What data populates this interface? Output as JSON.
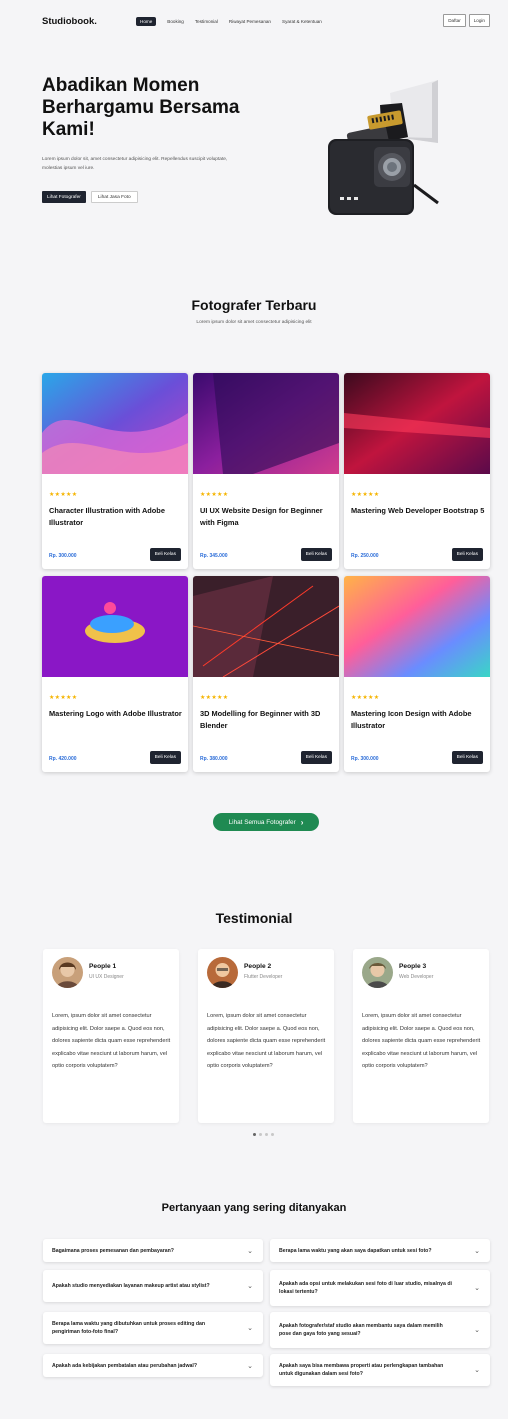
{
  "nav": {
    "brand": "Studiobook.",
    "items": [
      {
        "label": "Home"
      },
      {
        "label": "Booking"
      },
      {
        "label": "Testimonial"
      },
      {
        "label": "Riwayat Pemesanan"
      },
      {
        "label": "Syarat & Ketentuan"
      }
    ],
    "daftar": "Daftar",
    "login": "Login"
  },
  "hero": {
    "title": "Abadikan Momen Berhargamu Bersama Kami!",
    "description": "Lorem ipsum dolor sit, amet consectetur adipisicing elit. Repellendus suscipit voluptate, molestias ipsum vel iure.",
    "primary_button": "Lihat Fotografer",
    "secondary_button": "Lihat Jasa Foto"
  },
  "photographers": {
    "title": "Fotografer Terbaru",
    "subtitle": "Lorem ipsum dolor sit amet consectetur adipisicing elit",
    "cards": [
      {
        "title": "Character Illustration with Adobe Illustrator",
        "price": "Rp. 300.000",
        "button": "Beli Kelas",
        "rating": 5
      },
      {
        "title": "UI UX Website Design for Beginner with Figma",
        "price": "Rp. 345.000",
        "button": "Beli Kelas",
        "rating": 5
      },
      {
        "title": "Mastering Web Developer Bootstrap 5",
        "price": "Rp. 250.000",
        "button": "Beli Kelas",
        "rating": 5
      },
      {
        "title": "Mastering Logo with Adobe Illustrator",
        "price": "Rp. 420.000",
        "button": "Beli Kelas",
        "rating": 5
      },
      {
        "title": "3D Modelling for Beginner with 3D Blender",
        "price": "Rp. 380.000",
        "button": "Beli Kelas",
        "rating": 5
      },
      {
        "title": "Mastering Icon Design with Adobe Illustrator",
        "price": "Rp. 300.000",
        "button": "Beli Kelas",
        "rating": 5
      }
    ],
    "all_button": "Lihat Semua Fotografer"
  },
  "testimonial": {
    "title": "Testimonial",
    "items": [
      {
        "name": "People 1",
        "role": "UI UX Designer",
        "text": "Lorem, ipsum dolor sit amet consectetur adipisicing elit. Dolor saepe a. Quod eos non, dolores sapiente dicta quam esse reprehenderit explicabo vitae nesciunt ut laborum harum, vel optio corporis voluptatem?"
      },
      {
        "name": "People 2",
        "role": "Flutter Developer",
        "text": "Lorem, ipsum dolor sit amet consectetur adipisicing elit. Dolor saepe a. Quod eos non, dolores sapiente dicta quam esse reprehenderit explicabo vitae nesciunt ut laborum harum, vel optio corporis voluptatem?"
      },
      {
        "name": "People 3",
        "role": "Web Developer",
        "text": "Lorem, ipsum dolor sit amet consectetur adipisicing elit. Dolor saepe a. Quod eos non, dolores sapiente dicta quam esse reprehenderit explicabo vitae nesciunt ut laborum harum, vel optio corporis voluptatem?"
      }
    ]
  },
  "faq": {
    "title": "Pertanyaan yang sering ditanyakan",
    "items": [
      {
        "q": "Bagaimana proses pemesanan dan pembayaran?"
      },
      {
        "q": "Berapa lama waktu yang akan saya dapatkan untuk sesi foto?"
      },
      {
        "q": "Apakah studio menyediakan layanan makeup artist atau stylist?"
      },
      {
        "q": "Apakah ada opsi untuk melakukan sesi foto di luar studio, misalnya di lokasi tertentu?"
      },
      {
        "q": "Berapa lama waktu yang dibutuhkan untuk proses editing dan pengiriman foto-foto final?"
      },
      {
        "q": "Apakah fotografer/staf studio akan membantu saya dalam memilih pose dan gaya foto yang sesuai?"
      },
      {
        "q": "Apakah ada kebijakan pembatalan atau perubahan jadwal?"
      },
      {
        "q": "Apakah saya bisa membawa properti atau perlengkapan tambahan untuk digunakan dalam sesi foto?"
      }
    ]
  },
  "colors": {
    "accent_dark": "#1f2430",
    "accent_green": "#1f8a52",
    "price_blue": "#2a6cd8",
    "star": "#f5b400"
  },
  "icons": {
    "star": "star-icon",
    "chevron": "chevron-down-icon",
    "arrow": "chevron-right-icon"
  }
}
